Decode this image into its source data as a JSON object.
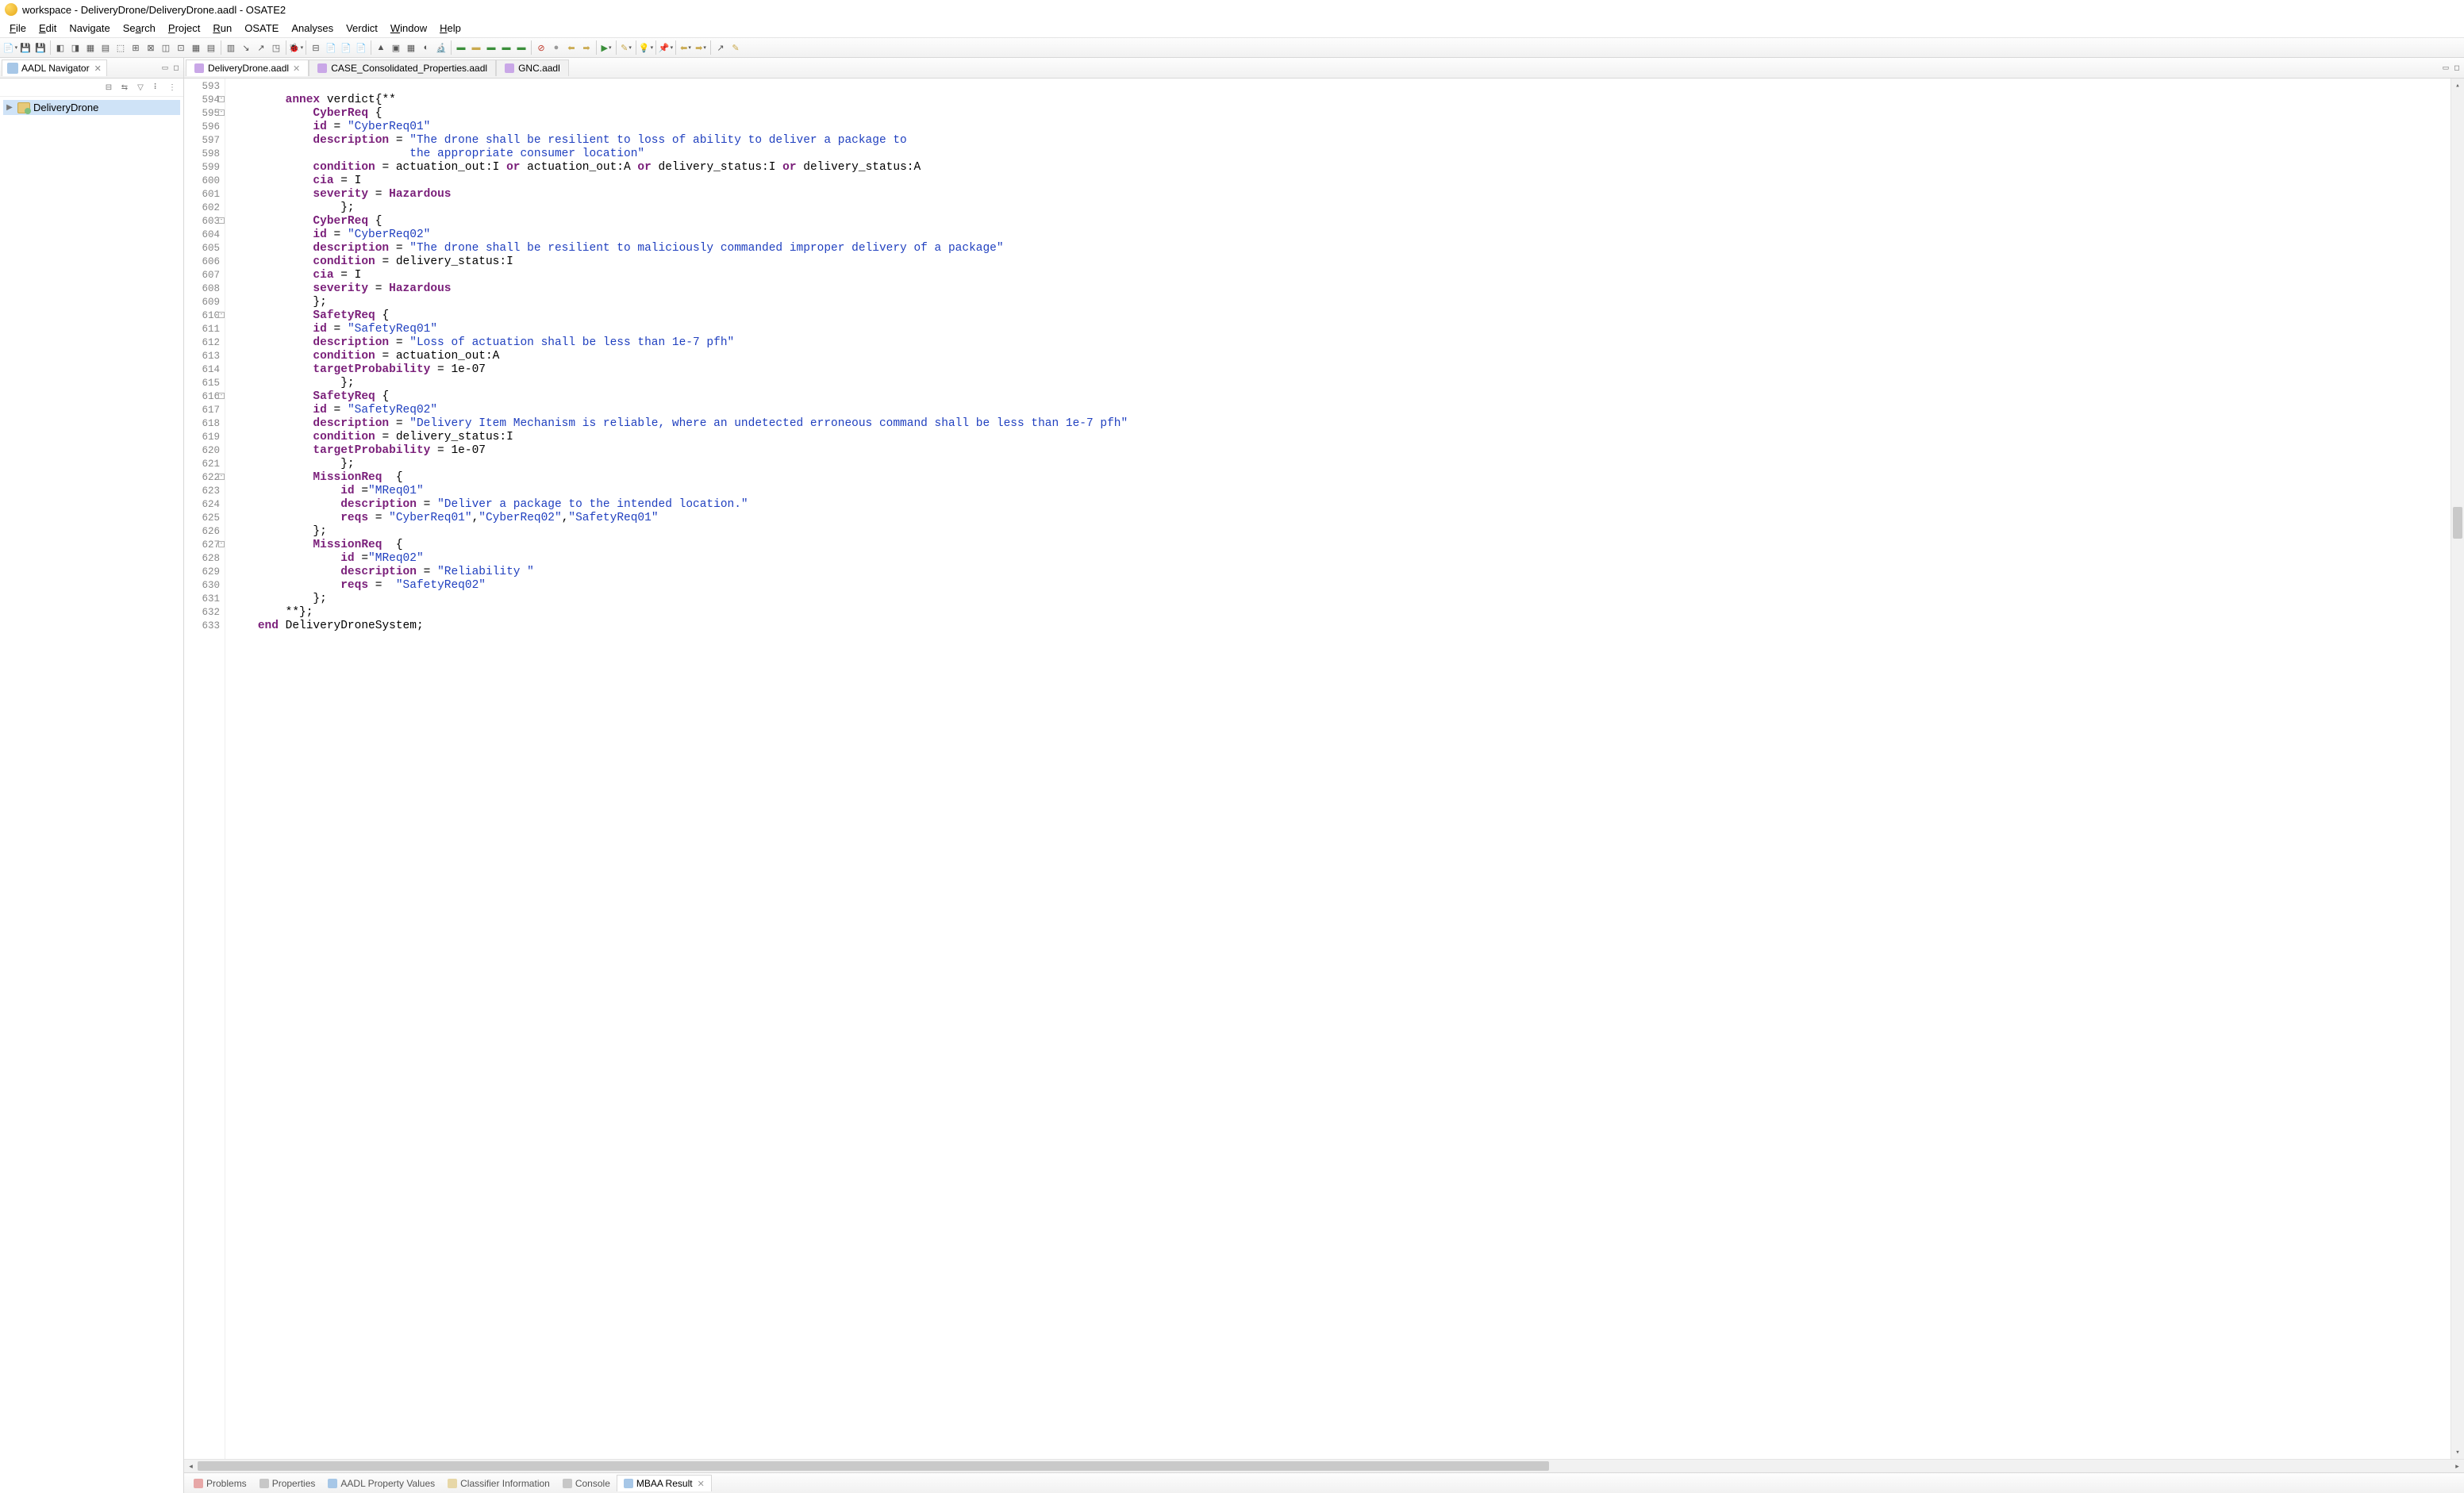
{
  "window": {
    "title": "workspace - DeliveryDrone/DeliveryDrone.aadl - OSATE2"
  },
  "menu": {
    "file": "File",
    "edit": "Edit",
    "navigate": "Navigate",
    "search": "Search",
    "project": "Project",
    "run": "Run",
    "osate": "OSATE",
    "analyses": "Analyses",
    "verdict": "Verdict",
    "window": "Window",
    "help": "Help"
  },
  "sidebar": {
    "tab": "AADL Navigator",
    "project": "DeliveryDrone"
  },
  "editor_tabs": {
    "t1": "DeliveryDrone.aadl",
    "t2": "CASE_Consolidated_Properties.aadl",
    "t3": "GNC.aadl"
  },
  "bottom_tabs": {
    "problems": "Problems",
    "properties": "Properties",
    "aadl": "AADL Property Values",
    "classifier": "Classifier Information",
    "console": "Console",
    "mbaa": "MBAA Result"
  },
  "line_start": 593,
  "code": {
    "l594": {
      "kw": "annex",
      "name": "verdict",
      "open": "{**"
    },
    "l595": {
      "ty": "CyberReq",
      "br": "{"
    },
    "l596": {
      "fld": "id",
      "eq": " = ",
      "str": "\"CyberReq01\""
    },
    "l597": {
      "fld": "description",
      "eq": " = ",
      "str": "\"The drone shall be resilient to loss of ability to deliver a package to"
    },
    "l598": {
      "str": "the appropriate consumer location\""
    },
    "l599": {
      "fld": "condition",
      "eq": " = ",
      "rest": "actuation_out:I or actuation_out:A or delivery_status:I or delivery_status:A"
    },
    "l600": {
      "fld": "cia",
      "eq": " = ",
      "rest": "I"
    },
    "l601": {
      "fld": "severity",
      "eq": " = ",
      "ty": "Hazardous"
    },
    "l602": {
      "rest": "};"
    },
    "l603": {
      "ty": "CyberReq",
      "br": "{"
    },
    "l604": {
      "fld": "id",
      "eq": " = ",
      "str": "\"CyberReq02\""
    },
    "l605": {
      "fld": "description",
      "eq": " = ",
      "str": "\"The drone shall be resilient to maliciously commanded improper delivery of a package\""
    },
    "l606": {
      "fld": "condition",
      "eq": " = ",
      "rest": "delivery_status:I"
    },
    "l607": {
      "fld": "cia",
      "eq": " = ",
      "rest": "I"
    },
    "l608": {
      "fld": "severity",
      "eq": " = ",
      "ty": "Hazardous"
    },
    "l609": {
      "rest": "};"
    },
    "l610": {
      "ty": "SafetyReq",
      "br": "{"
    },
    "l611": {
      "fld": "id",
      "eq": " = ",
      "str": "\"SafetyReq01\""
    },
    "l612": {
      "fld": "description",
      "eq": " = ",
      "str": "\"Loss of actuation shall be less than 1e-7 pfh\""
    },
    "l613": {
      "fld": "condition",
      "eq": " = ",
      "rest": "actuation_out:A"
    },
    "l614": {
      "fld": "targetProbability",
      "eq": " = ",
      "rest": "1e-07"
    },
    "l615": {
      "rest": "};"
    },
    "l616": {
      "ty": "SafetyReq",
      "br": "{"
    },
    "l617": {
      "fld": "id",
      "eq": " = ",
      "str": "\"SafetyReq02\""
    },
    "l618": {
      "fld": "description",
      "eq": " = ",
      "str": "\"Delivery Item Mechanism is reliable, where an undetected erroneous command shall be less than 1e-7 pfh\""
    },
    "l619": {
      "fld": "condition",
      "eq": " = ",
      "rest": "delivery_status:I"
    },
    "l620": {
      "fld": "targetProbability",
      "eq": " = ",
      "rest": "1e-07"
    },
    "l621": {
      "rest": "};"
    },
    "l622": {
      "ty": "MissionReq",
      "br": "{"
    },
    "l623": {
      "fld": "id",
      "eq": " =",
      "str": "\"MReq01\""
    },
    "l624": {
      "fld": "description",
      "eq": " = ",
      "str": "\"Deliver a package to the intended location.\""
    },
    "l625": {
      "fld": "reqs",
      "eq": " = ",
      "strs": [
        "\"CyberReq01\"",
        "\"CyberReq02\"",
        "\"SafetyReq01\""
      ]
    },
    "l626": {
      "rest": "};"
    },
    "l627": {
      "ty": "MissionReq",
      "br": "{"
    },
    "l628": {
      "fld": "id",
      "eq": " =",
      "str": "\"MReq02\""
    },
    "l629": {
      "fld": "description",
      "eq": " = ",
      "str": "\"Reliability \""
    },
    "l630": {
      "fld": "reqs",
      "eq": " =  ",
      "strs": [
        "\"SafetyReq02\""
      ]
    },
    "l631": {
      "rest": "};"
    },
    "l632": {
      "rest": "**};"
    },
    "l633": {
      "kw": "end",
      "name": "DeliveryDroneSystem;"
    }
  }
}
